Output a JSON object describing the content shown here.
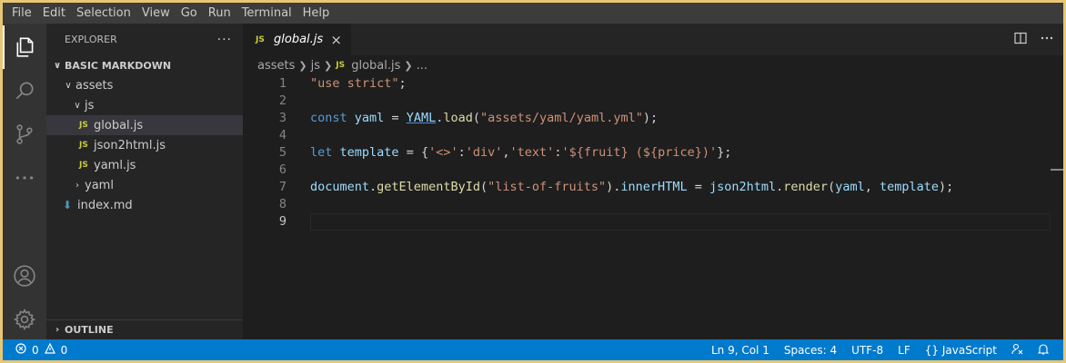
{
  "menu": [
    "File",
    "Edit",
    "Selection",
    "View",
    "Go",
    "Run",
    "Terminal",
    "Help"
  ],
  "activity": {
    "items": [
      "explorer-icon",
      "search-icon",
      "source-control-icon",
      "more-icon",
      "account-icon",
      "gear-icon"
    ]
  },
  "sidebar": {
    "title": "EXPLORER",
    "more": "···",
    "workspace": "BASIC MARKDOWN",
    "tree": [
      {
        "label": "assets",
        "kind": "folder"
      },
      {
        "label": "js",
        "kind": "folder"
      },
      {
        "label": "global.js",
        "kind": "js",
        "badge": "JS"
      },
      {
        "label": "json2html.js",
        "kind": "js",
        "badge": "JS"
      },
      {
        "label": "yaml.js",
        "kind": "js",
        "badge": "JS"
      },
      {
        "label": "yaml",
        "kind": "folder"
      },
      {
        "label": "index.md",
        "kind": "md"
      }
    ],
    "outline": "OUTLINE"
  },
  "editor": {
    "tab": {
      "badge": "JS",
      "title": "global.js",
      "close": "×"
    },
    "breadcrumb": [
      "assets",
      "js",
      "global.js",
      "..."
    ],
    "breadcrumb_badge": "JS",
    "current_line": 9
  },
  "statusbar": {
    "errors": "0",
    "warnings": "0",
    "position": "Ln 9, Col 1",
    "spaces": "Spaces: 4",
    "encoding": "UTF-8",
    "eol": "LF",
    "language": "JavaScript",
    "language_prefix": "{}"
  },
  "colors": {
    "accent": "#007acc",
    "frame": "#e8c774"
  }
}
